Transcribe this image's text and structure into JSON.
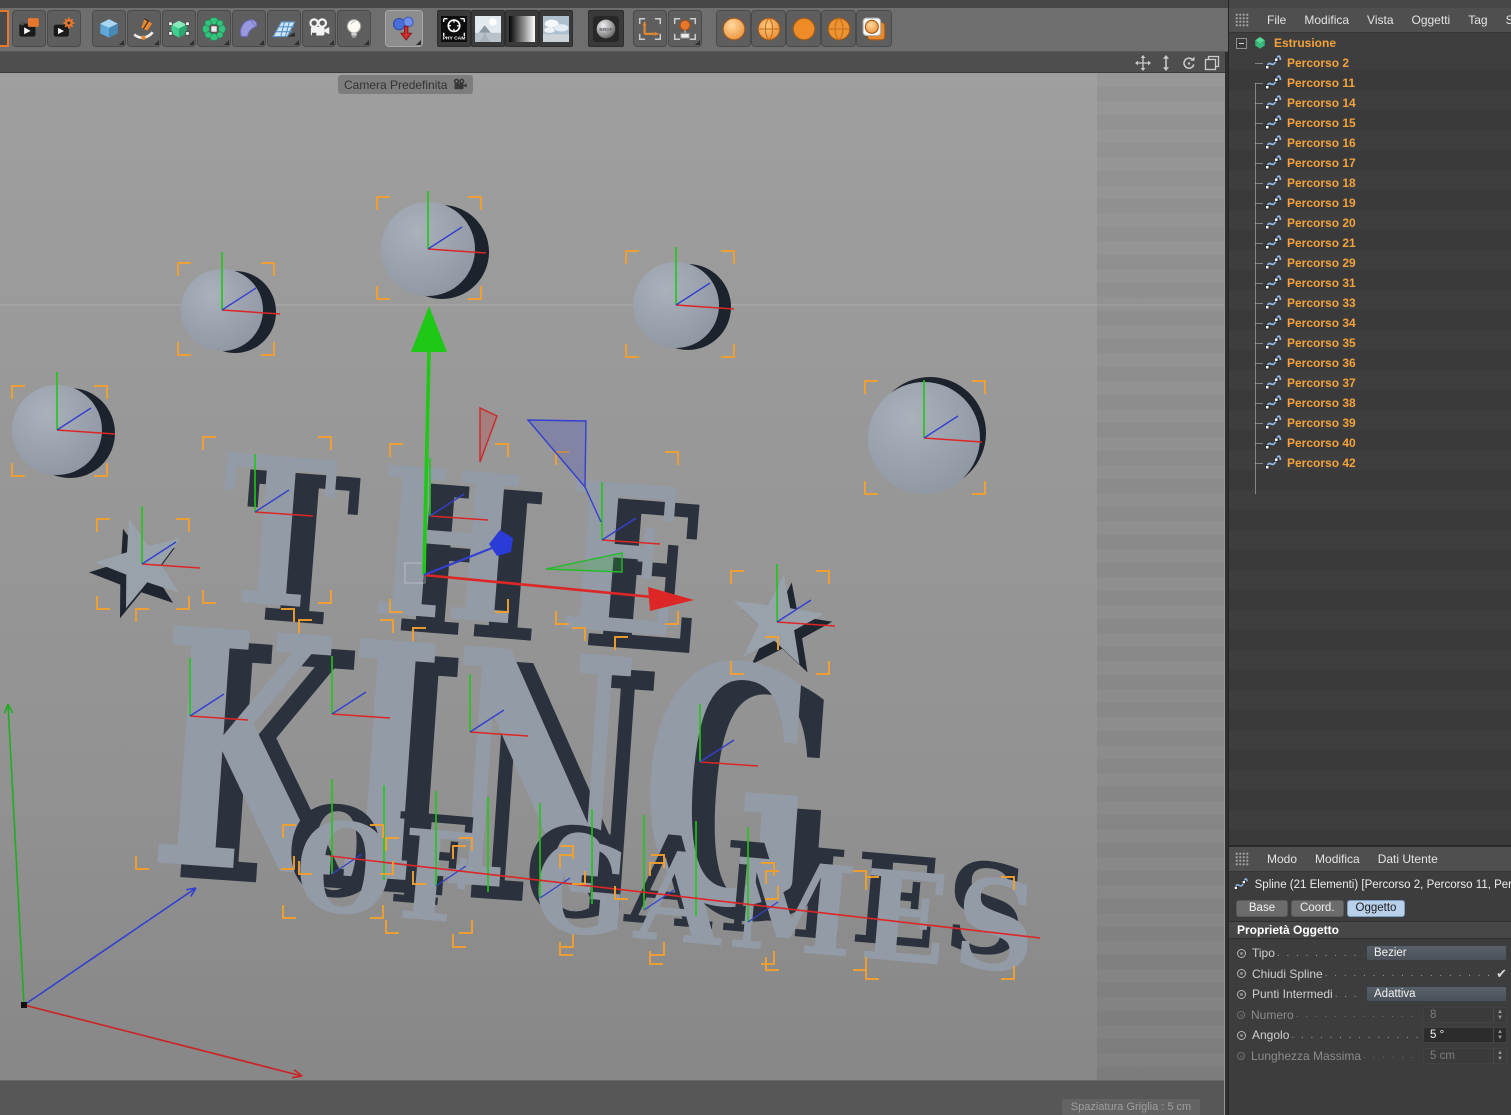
{
  "viewport": {
    "camera_label": "Camera Predefinita",
    "grid_label": "Spaziatura Griglia : 5 cm",
    "logo": {
      "line1": "THE",
      "line2": "KING",
      "line3": "OF GAMES"
    }
  },
  "toolbar": {
    "phy_cam_label": "PHY CAM",
    "brdf_label": "BRDF",
    "tools": [
      "render-view",
      "render-settings",
      "add-primitive-cube",
      "spline-pen",
      "subdivision-surface",
      "deformer",
      "volume-mesh",
      "floor",
      "camera",
      "light",
      "simulate-gravity",
      "physical-camera",
      "sky-preset",
      "gradient-preset",
      "clouds-preset",
      "brdf-material",
      "axis-modify",
      "axis-center",
      "material-sphere-shaded",
      "material-sphere-lined",
      "material-sphere-flat",
      "material-sphere-banded",
      "material-layer"
    ]
  },
  "viewport_controls": [
    "pan",
    "dolly",
    "rotate",
    "maximize"
  ],
  "object_manager": {
    "menu": [
      "File",
      "Modifica",
      "Vista",
      "Oggetti",
      "Tag",
      "Segnalibri"
    ],
    "root_label": "Estrusione",
    "children": [
      "Percorso 2",
      "Percorso 11",
      "Percorso 14",
      "Percorso 15",
      "Percorso 16",
      "Percorso 17",
      "Percorso 18",
      "Percorso 19",
      "Percorso 20",
      "Percorso 21",
      "Percorso 29",
      "Percorso 31",
      "Percorso 33",
      "Percorso 34",
      "Percorso 35",
      "Percorso 36",
      "Percorso 37",
      "Percorso 38",
      "Percorso 39",
      "Percorso 40",
      "Percorso 42"
    ]
  },
  "attribute_manager": {
    "menu": [
      "Modo",
      "Modifica",
      "Dati Utente"
    ],
    "info": "Spline (21 Elementi) [Percorso 2, Percorso 11, Per",
    "tabs": [
      "Base",
      "Coord.",
      "Oggetto"
    ],
    "active_tab": "Oggetto",
    "section": "Proprietà Oggetto",
    "rows": [
      {
        "label": "Tipo",
        "control": "dropdown",
        "value": "Bezier",
        "enabled": true
      },
      {
        "label": "Chiudi Spline",
        "control": "check",
        "checked": true,
        "enabled": true
      },
      {
        "label": "Punti Intermedi",
        "control": "dropdown",
        "value": "Adattiva",
        "enabled": true
      },
      {
        "label": "Numero",
        "control": "number",
        "value": "8",
        "enabled": false
      },
      {
        "label": "Angolo",
        "control": "number",
        "value": "5 °",
        "enabled": true
      },
      {
        "label": "Lunghezza Massima",
        "control": "number",
        "value": "5 cm",
        "enabled": false
      }
    ]
  },
  "colors": {
    "selection_orange": "#f0a035",
    "tree_text_orange": "#f4a23b",
    "axis_green": "#1fc717",
    "axis_red": "#dd2626",
    "axis_blue": "#3340cf",
    "active_tab_blue": "#b9d0ea",
    "viewport_grey": "#969696"
  }
}
